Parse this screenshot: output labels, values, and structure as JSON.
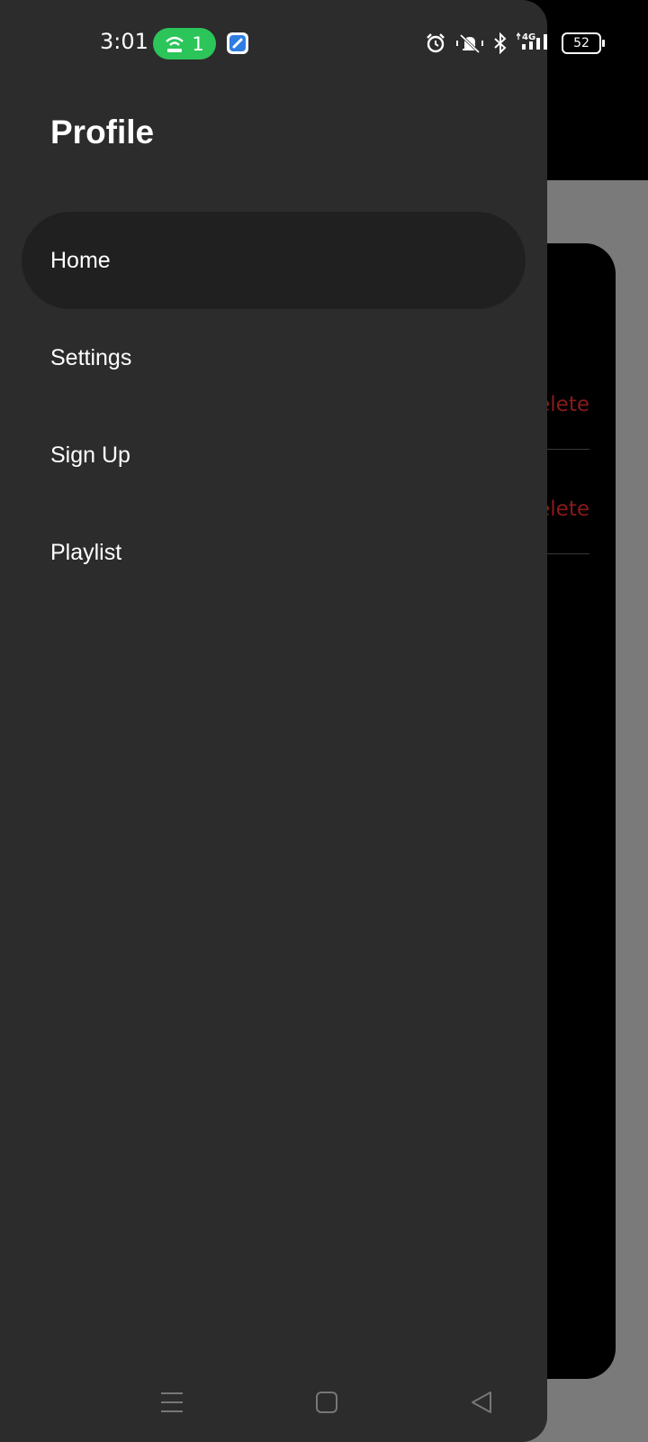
{
  "status_bar": {
    "time": "3:01",
    "hotspot_count": "1",
    "network": "4G",
    "battery": "52",
    "icons": [
      "hotspot-icon",
      "app-notification-icon",
      "alarm-icon",
      "vibrate-mute-icon",
      "bluetooth-icon",
      "signal-icon",
      "battery-icon"
    ]
  },
  "drawer": {
    "title": "Profile",
    "items": [
      {
        "label": "Home",
        "active": true
      },
      {
        "label": "Settings",
        "active": false
      },
      {
        "label": "Sign Up",
        "active": false
      },
      {
        "label": "Playlist",
        "active": false
      }
    ]
  },
  "background": {
    "rows": [
      {
        "action_label": "elete"
      },
      {
        "action_label": "elete"
      }
    ]
  },
  "nav_bar": {
    "icons": [
      "menu-icon",
      "home-icon",
      "back-icon"
    ]
  },
  "colors": {
    "drawer_bg": "#2c2c2c",
    "active_item_bg": "#202020",
    "hotspot_pill": "#2bc55a",
    "delete_text": "#8a1a1a"
  }
}
